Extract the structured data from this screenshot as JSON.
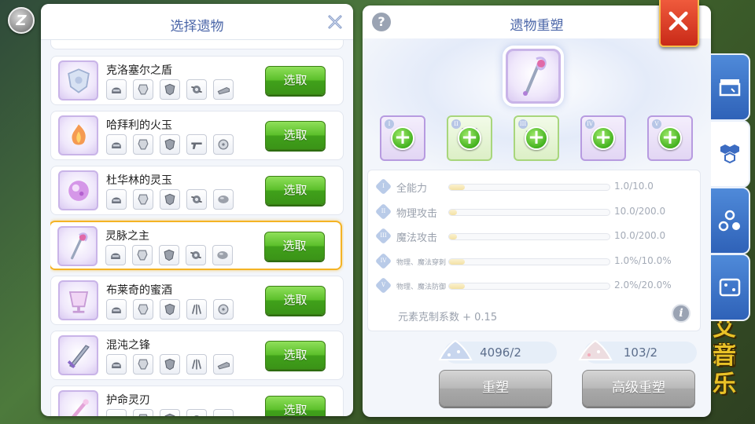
{
  "background": {
    "right_text_line1": "艾莉",
    "right_text_line2": "音乐"
  },
  "left_panel": {
    "title": "选择遗物",
    "pick_label": "选取",
    "items": [
      {
        "name": "克洛塞尔之盾",
        "selected": false,
        "icon": "shield-relic-icon",
        "minis": [
          "helmet-icon",
          "armor-icon",
          "shield-icon",
          "gear-icon",
          "boots-icon"
        ]
      },
      {
        "name": "哈拜利的火玉",
        "selected": false,
        "icon": "fire-orb-icon",
        "minis": [
          "helmet-icon",
          "armor-icon",
          "shield-icon",
          "gun-icon",
          "accessory-icon"
        ]
      },
      {
        "name": "杜华林的灵玉",
        "selected": false,
        "icon": "spirit-orb-icon",
        "minis": [
          "helmet-icon",
          "armor-icon",
          "shield-icon",
          "gear-icon",
          "stone-icon"
        ]
      },
      {
        "name": "灵脉之主",
        "selected": true,
        "icon": "spirit-staff-icon",
        "minis": [
          "helmet-icon",
          "armor-icon",
          "shield-icon",
          "gear-icon",
          "stone-icon"
        ]
      },
      {
        "name": "布莱奇的蜜酒",
        "selected": false,
        "icon": "mead-cup-icon",
        "minis": [
          "helmet-icon",
          "armor-icon",
          "shield-icon",
          "claw-icon",
          "accessory-icon"
        ]
      },
      {
        "name": "混沌之锋",
        "selected": false,
        "icon": "chaos-blade-icon",
        "minis": [
          "helmet-icon",
          "armor-icon",
          "shield-icon",
          "claw-icon",
          "boots-icon"
        ]
      },
      {
        "name": "护命灵刃",
        "selected": false,
        "icon": "life-blade-icon",
        "minis": [
          "helmet-icon",
          "armor-icon",
          "shield-icon",
          "gear-icon",
          "boots-icon"
        ]
      }
    ]
  },
  "right_panel": {
    "title": "遗物重塑",
    "help": "?",
    "slots": [
      {
        "numeral": "I",
        "style": "purple"
      },
      {
        "numeral": "II",
        "style": "green"
      },
      {
        "numeral": "III",
        "style": "green"
      },
      {
        "numeral": "IV",
        "style": "purple"
      },
      {
        "numeral": "V",
        "style": "purple"
      }
    ],
    "stats": [
      {
        "numeral": "I",
        "label": "全能力",
        "value": "1.0/10.0",
        "fraction": 0.1,
        "small": false
      },
      {
        "numeral": "II",
        "label": "物理攻击",
        "value": "10.0/200.0",
        "fraction": 0.05,
        "small": false
      },
      {
        "numeral": "III",
        "label": "魔法攻击",
        "value": "10.0/200.0",
        "fraction": 0.05,
        "small": false
      },
      {
        "numeral": "IV",
        "label": "物理、魔法穿刺",
        "value": "1.0%/10.0%",
        "fraction": 0.1,
        "small": true
      },
      {
        "numeral": "V",
        "label": "物理、魔法防御",
        "value": "2.0%/20.0%",
        "fraction": 0.1,
        "small": true
      }
    ],
    "element_line": "元素克制系数 + 0.15",
    "info": "i",
    "costs": [
      {
        "value": "4096/2",
        "icon": "blue-powder-icon"
      },
      {
        "value": "103/2",
        "icon": "pink-powder-icon"
      }
    ],
    "reshape_label": "重塑",
    "advanced_reshape_label": "高级重塑"
  },
  "colors": {
    "accent_blue": "#4b66a8",
    "pick_green": "#5cbf2b",
    "selected_border": "#f4b324",
    "close_red": "#d6371f"
  }
}
